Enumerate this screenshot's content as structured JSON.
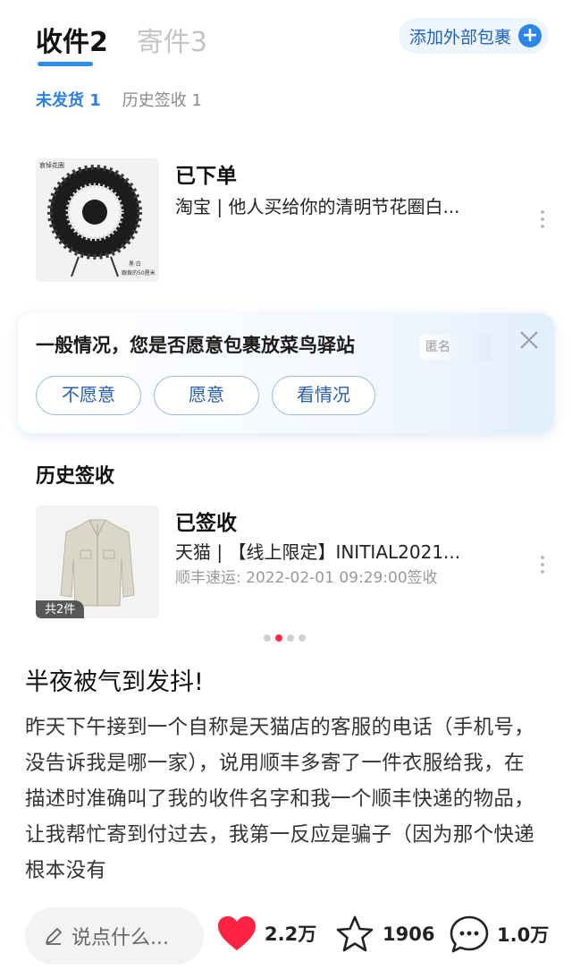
{
  "tabs": {
    "receive": "收件2",
    "send": "寄件3",
    "add_external": "添加外部包裹"
  },
  "subtabs": {
    "unshipped": "未发货 1",
    "history": "历史签收 1"
  },
  "pending_package": {
    "status": "已下单",
    "description": "淘宝 | 他人买给你的清明节花圈白...",
    "thumbnail_tag_top": "哀悼花圈",
    "thumbnail_tag_bottom": "黑·白\n跟拨的50厘米"
  },
  "popup": {
    "question": "一般情况，您是否愿意包裹放菜鸟驿站",
    "anon_tag": "匿名",
    "options": [
      "不愿意",
      "愿意",
      "看情况"
    ]
  },
  "history": {
    "title": "历史签收",
    "status": "已签收",
    "description": "天猫 | 【线上限定】INITIAL2021...",
    "detail": "顺丰速运: 2022-02-01 09:29:00签收",
    "count_tag": "共2件"
  },
  "pager": {
    "count": 4,
    "active_index": 1
  },
  "post": {
    "title": "半夜被气到发抖!",
    "body": "昨天下午接到一个自称是天猫店的客服的电话（手机号，没告诉我是哪一家），说用顺丰多寄了一件衣服给我，在描述时准确叫了我的收件名字和我一个顺丰快递的物品，让我帮忙寄到付过去，我第一反应是骗子（因为那个快递根本没有"
  },
  "bottombar": {
    "comment_placeholder": "说点什么...",
    "likes": "2.2万",
    "favorites": "1906",
    "comments": "1.0万"
  },
  "colors": {
    "accent_blue": "#2d8cf0",
    "like_red": "#ff2442"
  }
}
